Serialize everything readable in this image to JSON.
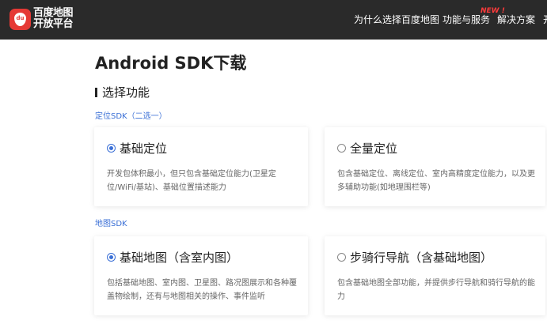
{
  "header": {
    "logo_line1": "百度地图",
    "logo_line2": "开放平台",
    "logo_mark": "du",
    "nav_items": [
      "为什么选择百度地图",
      "功能与服务",
      "解决方案",
      "开"
    ],
    "new_tag": "NEW !"
  },
  "page": {
    "title": "Android SDK下载",
    "section_title": "选择功能"
  },
  "groups": [
    {
      "label": "定位SDK（二选一）",
      "options": [
        {
          "title": "基础定位",
          "selected": true,
          "desc": "开发包体积最小，但只包含基础定位能力(卫星定位/WiFi/基站)、基础位置描述能力"
        },
        {
          "title": "全量定位",
          "selected": false,
          "desc": "包含基础定位、离线定位、室内高精度定位能力，以及更多辅助功能(如地理围栏等)"
        }
      ]
    },
    {
      "label": "地图SDK",
      "options": [
        {
          "title": "基础地图（含室内图）",
          "selected": true,
          "desc": "包括基础地图、室内图、卫星图、路况图展示和各种覆盖物绘制，还有与地图相关的操作、事件监听"
        },
        {
          "title": "步骑行导航（含基础地图）",
          "selected": false,
          "desc": "包含基础地图全部功能，并提供步行导航和骑行导航的能力"
        }
      ]
    }
  ],
  "colors": {
    "header_bg": "#2a2a2a",
    "accent": "#3a6fd6",
    "new_tag": "#ff3b3b",
    "logo_red": "#e53935"
  },
  "icons": {
    "logo": "baidu-map-logo-icon",
    "radio_on": "radio-checked-icon",
    "radio_off": "radio-unchecked-icon"
  }
}
